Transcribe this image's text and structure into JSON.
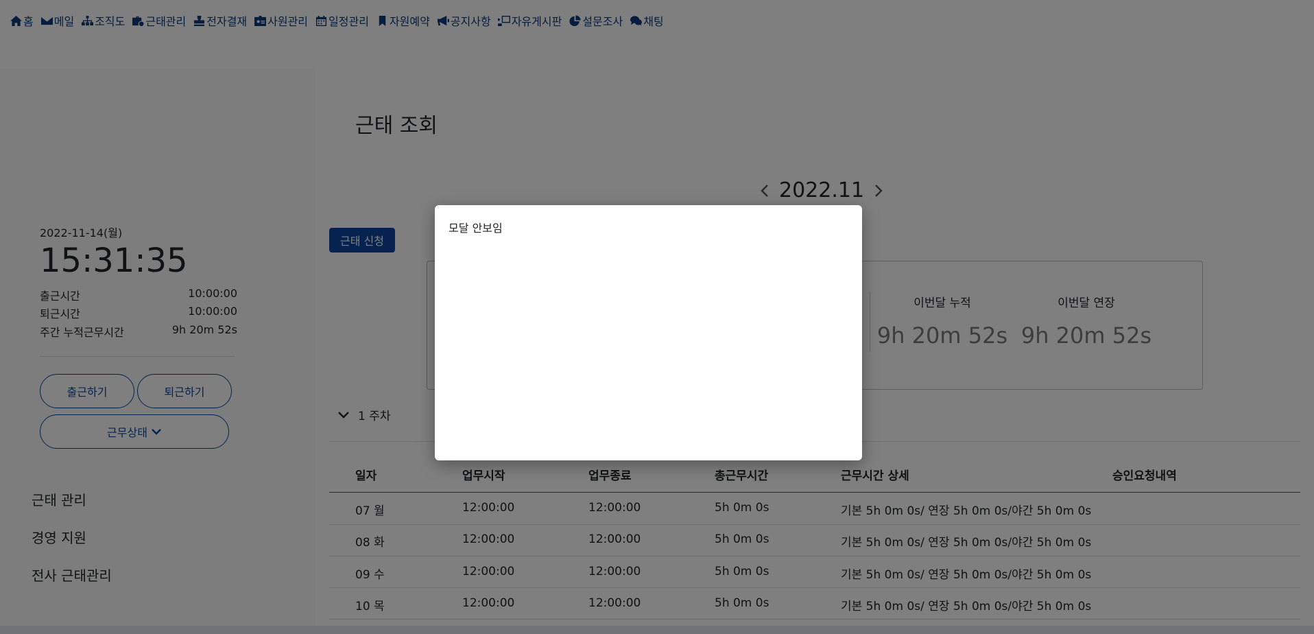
{
  "nav": [
    {
      "label": "홈",
      "icon": "home-icon"
    },
    {
      "label": "메일",
      "icon": "envelope-icon"
    },
    {
      "label": "조직도",
      "icon": "sitemap-icon"
    },
    {
      "label": "근태관리",
      "icon": "briefcase-clock-icon"
    },
    {
      "label": "전자결재",
      "icon": "stamp-icon"
    },
    {
      "label": "사원관리",
      "icon": "id-badge-icon"
    },
    {
      "label": "일정관리",
      "icon": "calendar-icon"
    },
    {
      "label": "자원예약",
      "icon": "bookmark-icon"
    },
    {
      "label": "공지사항",
      "icon": "megaphone-icon"
    },
    {
      "label": "자유게시판",
      "icon": "board-icon"
    },
    {
      "label": "설문조사",
      "icon": "pie-chart-icon"
    },
    {
      "label": "채팅",
      "icon": "chat-icon"
    }
  ],
  "sidebar": {
    "date": "2022-11-14(월)",
    "clock": "15:31:35",
    "rows": [
      {
        "label": "출근시간",
        "value": "10:00:00"
      },
      {
        "label": "퇴근시간",
        "value": "10:00:00"
      },
      {
        "label": "주간 누적근무시간",
        "value": "9h 20m 52s"
      }
    ],
    "checkin_label": "출근하기",
    "checkout_label": "퇴근하기",
    "status_label": "근무상태",
    "links": [
      "근태 관리",
      "경영 지원",
      "전사 근태관리"
    ]
  },
  "main": {
    "title": "근태 조회",
    "month": "2022.11",
    "apply_label": "근태 신청",
    "stats": [
      {
        "label": "이번달 누적",
        "value": "9h 20m 52s"
      },
      {
        "label": "이번달 연장",
        "value": "9h 20m 52s"
      }
    ],
    "week_label": "1 주차",
    "table": {
      "headers": [
        "일자",
        "업무시작",
        "업무종료",
        "총근무시간",
        "근무시간 상세",
        "승인요청내역"
      ],
      "rows": [
        [
          "07 월",
          "12:00:00",
          "12:00:00",
          "5h 0m 0s",
          "기본 5h 0m 0s/ 연장 5h 0m 0s/야간 5h 0m 0s",
          ""
        ],
        [
          "08 화",
          "12:00:00",
          "12:00:00",
          "5h 0m 0s",
          "기본 5h 0m 0s/ 연장 5h 0m 0s/야간 5h 0m 0s",
          ""
        ],
        [
          "09 수",
          "12:00:00",
          "12:00:00",
          "5h 0m 0s",
          "기본 5h 0m 0s/ 연장 5h 0m 0s/야간 5h 0m 0s",
          ""
        ],
        [
          "10 목",
          "12:00:00",
          "12:00:00",
          "5h 0m 0s",
          "기본 5h 0m 0s/ 연장 5h 0m 0s/야간 5h 0m 0s",
          ""
        ]
      ]
    }
  },
  "modal": {
    "text": "모달 안보임"
  },
  "colors": {
    "accent": "#0d47a1",
    "nav": "#0d3b7a",
    "overlay": "rgba(0,0,0,0.5)"
  }
}
